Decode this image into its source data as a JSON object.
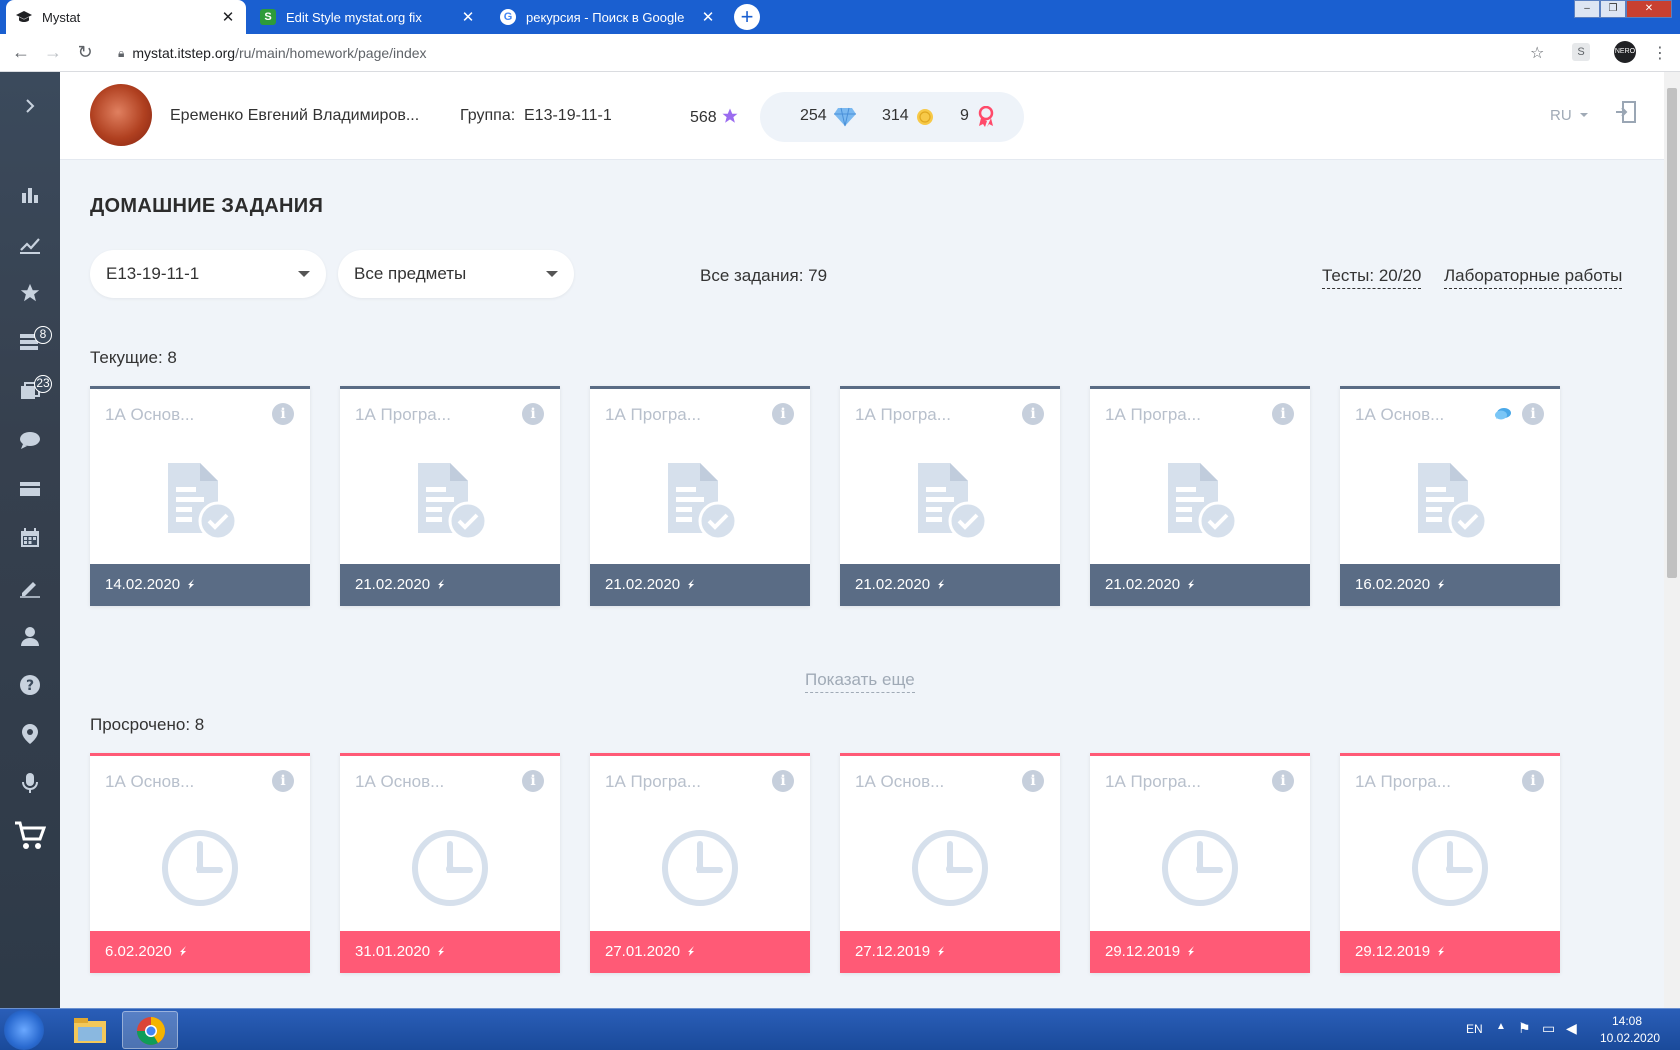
{
  "browser": {
    "tabs": [
      {
        "title": "Mystat",
        "icon": "graduation-cap-icon"
      },
      {
        "title": "Edit Style mystat.org fix",
        "icon": "stylus-icon"
      },
      {
        "title": "рекурсия - Поиск в Google",
        "icon": "google-icon"
      }
    ],
    "url_host": "mystat.itstep.org",
    "url_path": "/ru/main/homework/page/index"
  },
  "sidebar": {
    "badges": {
      "homework_list": "8",
      "assignments": "23"
    }
  },
  "header": {
    "user_name": "Еременко Евгений Владимиров...",
    "group_label": "Группа:",
    "group_value": "Е13-19-11-1",
    "stars": "568",
    "diamonds": "254",
    "coins": "314",
    "badges": "9",
    "lang": "RU"
  },
  "main": {
    "title": "ДОМАШНИЕ ЗАДАНИЯ",
    "group_select": "Е13-19-11-1",
    "subject_select": "Все предметы",
    "total": "Все задания: 79",
    "tests_link": "Тесты: 20/20",
    "labs_link": "Лабораторные работы",
    "show_more": "Показать еще"
  },
  "current": {
    "label": "Текущие: 8",
    "cards": [
      {
        "subject": "1А Основ...",
        "date": "14.02.2020"
      },
      {
        "subject": "1А Програ...",
        "date": "21.02.2020"
      },
      {
        "subject": "1А Програ...",
        "date": "21.02.2020"
      },
      {
        "subject": "1А Програ...",
        "date": "21.02.2020"
      },
      {
        "subject": "1А Програ...",
        "date": "21.02.2020"
      },
      {
        "subject": "1А Основ...",
        "date": "16.02.2020",
        "has_comment": true
      }
    ]
  },
  "overdue": {
    "label": "Просрочено: 8",
    "cards": [
      {
        "subject": "1А Основ...",
        "date": "6.02.2020"
      },
      {
        "subject": "1А Основ...",
        "date": "31.01.2020"
      },
      {
        "subject": "1А Програ...",
        "date": "27.01.2020"
      },
      {
        "subject": "1А Основ...",
        "date": "27.12.2019"
      },
      {
        "subject": "1А Програ...",
        "date": "29.12.2019"
      },
      {
        "subject": "1А Програ...",
        "date": "29.12.2019"
      }
    ]
  },
  "taskbar": {
    "lang": "EN",
    "time": "14:08",
    "date": "10.02.2020"
  },
  "colors": {
    "current": "#5a6c85",
    "overdue": "#ff5a76"
  }
}
